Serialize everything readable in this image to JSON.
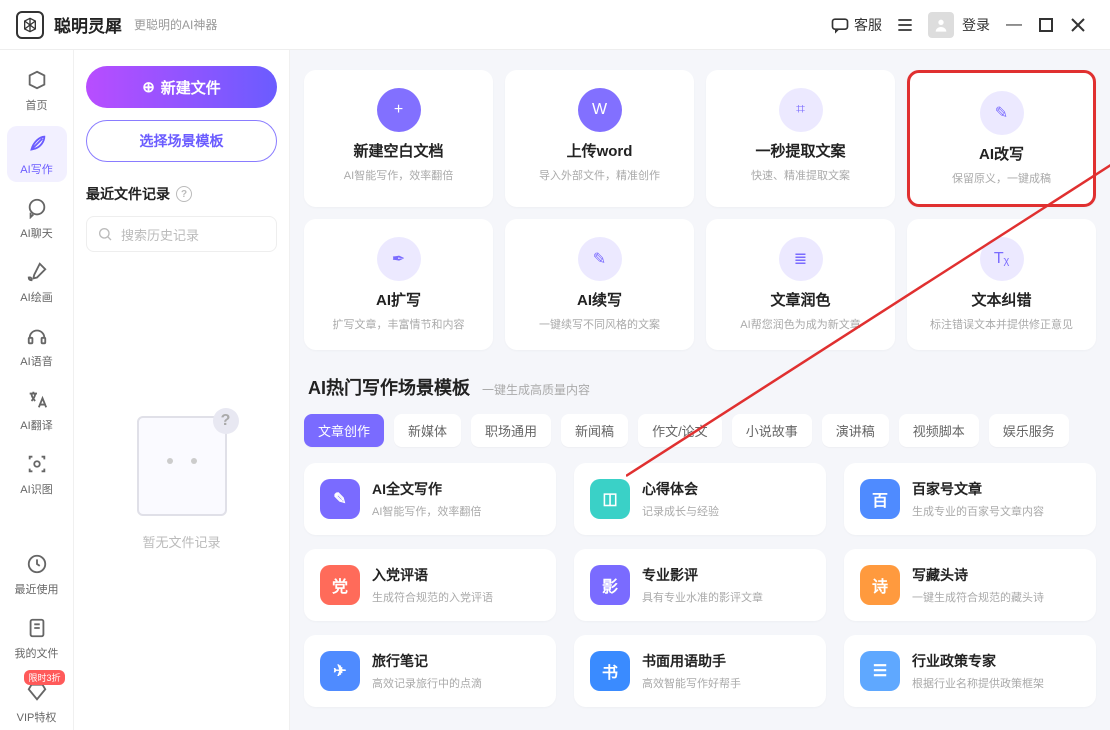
{
  "titlebar": {
    "appName": "聪明灵犀",
    "tagline": "更聪明的AI神器",
    "support": "客服",
    "login": "登录"
  },
  "nav": {
    "items": [
      {
        "id": "home",
        "label": "首页"
      },
      {
        "id": "write",
        "label": "AI写作"
      },
      {
        "id": "chat",
        "label": "AI聊天"
      },
      {
        "id": "draw",
        "label": "AI绘画"
      },
      {
        "id": "voice",
        "label": "AI语音"
      },
      {
        "id": "translate",
        "label": "AI翻译"
      },
      {
        "id": "ocr",
        "label": "AI识图"
      }
    ],
    "bottom": [
      {
        "id": "recent",
        "label": "最近使用"
      },
      {
        "id": "files",
        "label": "我的文件"
      },
      {
        "id": "vip",
        "label": "VIP特权",
        "badge": "限时3折"
      }
    ]
  },
  "leftPanel": {
    "newFile": "新建文件",
    "chooseTemplate": "选择场景模板",
    "recentHeader": "最近文件记录",
    "searchPlaceholder": "搜索历史记录",
    "emptyLabel": "暂无文件记录"
  },
  "featureCards": [
    {
      "id": "new-doc",
      "title": "新建空白文档",
      "desc": "AI智能写作，效率翻倍",
      "circClass": "purple",
      "glyph": "+"
    },
    {
      "id": "upload-word",
      "title": "上传word",
      "desc": "导入外部文件，精准创作",
      "circClass": "purple",
      "glyph": "W"
    },
    {
      "id": "extract",
      "title": "一秒提取文案",
      "desc": "快速、精准提取文案",
      "circClass": "lav",
      "glyph": "⌗"
    },
    {
      "id": "rewrite",
      "title": "AI改写",
      "desc": "保留原义，一键成稿",
      "circClass": "lav",
      "glyph": "✎",
      "highlight": true
    },
    {
      "id": "expand",
      "title": "AI扩写",
      "desc": "扩写文章，丰富情节和内容",
      "circClass": "lav",
      "glyph": "✒"
    },
    {
      "id": "continue",
      "title": "AI续写",
      "desc": "一键续写不同风格的文案",
      "circClass": "lav",
      "glyph": "✎"
    },
    {
      "id": "polish",
      "title": "文章润色",
      "desc": "AI帮您润色为成为新文章",
      "circClass": "lav",
      "glyph": "≣"
    },
    {
      "id": "correct",
      "title": "文本纠错",
      "desc": "标注错误文本并提供修正意见",
      "circClass": "lav",
      "glyph": "Tᵪ"
    }
  ],
  "templates": {
    "header": "AI热门写作场景模板",
    "sub": "一键生成高质量内容",
    "tabs": [
      "文章创作",
      "新媒体",
      "职场通用",
      "新闻稿",
      "作文/论文",
      "小说故事",
      "演讲稿",
      "视频脚本",
      "娱乐服务"
    ],
    "activeTab": 0,
    "items": [
      {
        "title": "AI全文写作",
        "desc": "AI智能写作，效率翻倍",
        "color": "#7a6bff",
        "glyph": "✎"
      },
      {
        "title": "心得体会",
        "desc": "记录成长与经验",
        "color": "#3ad1c7",
        "glyph": "◫"
      },
      {
        "title": "百家号文章",
        "desc": "生成专业的百家号文章内容",
        "color": "#4f8bff",
        "glyph": "百"
      },
      {
        "title": "入党评语",
        "desc": "生成符合规范的入党评语",
        "color": "#ff6b5a",
        "glyph": "党"
      },
      {
        "title": "专业影评",
        "desc": "具有专业水准的影评文章",
        "color": "#7a6bff",
        "glyph": "影"
      },
      {
        "title": "写藏头诗",
        "desc": "一键生成符合规范的藏头诗",
        "color": "#ff9a3e",
        "glyph": "诗"
      },
      {
        "title": "旅行笔记",
        "desc": "高效记录旅行中的点滴",
        "color": "#4f8bff",
        "glyph": "✈"
      },
      {
        "title": "书面用语助手",
        "desc": "高效智能写作好帮手",
        "color": "#3a8bff",
        "glyph": "书"
      },
      {
        "title": "行业政策专家",
        "desc": "根据行业名称提供政策框架",
        "color": "#5fa8ff",
        "glyph": "☰"
      }
    ]
  },
  "annotation": {
    "highlightCard": "rewrite"
  }
}
